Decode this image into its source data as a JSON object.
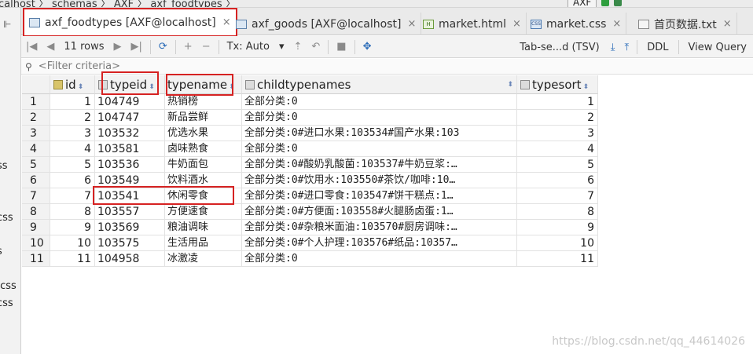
{
  "breadcrumb": {
    "path": "calhost 〉 schemas 〉 AXF 〉 axf_foodtypes 〉",
    "config": "AXF"
  },
  "sidebar": {
    "fragments": [
      "ss",
      "css",
      "s",
      ".css",
      "css"
    ]
  },
  "tabs": [
    {
      "label": "axf_foodtypes [AXF@localhost]",
      "icon": "table-icon",
      "active": true,
      "closable": true
    },
    {
      "label": "axf_goods [AXF@localhost]",
      "icon": "table-icon",
      "active": false,
      "closable": true
    },
    {
      "label": "market.html",
      "icon": "html-file-icon",
      "active": false,
      "closable": true
    },
    {
      "label": "market.css",
      "icon": "css-file-icon",
      "active": false,
      "closable": true
    },
    {
      "label": "首页数据.txt",
      "icon": "text-file-icon",
      "active": false,
      "closable": true
    }
  ],
  "toolbar": {
    "rows_label": "11 rows",
    "tx_label": "Tx: Auto",
    "format_label": "Tab-se...d (TSV)",
    "ddl_label": "DDL",
    "view_query_label": "View Query"
  },
  "filter": {
    "placeholder": "<Filter criteria>"
  },
  "columns": [
    {
      "name": "id",
      "icon": "key-column-icon"
    },
    {
      "name": "typeid",
      "icon": "column-icon"
    },
    {
      "name": "typename",
      "icon": "column-icon"
    },
    {
      "name": "childtypenames",
      "icon": "column-icon"
    },
    {
      "name": "typesort",
      "icon": "column-icon"
    }
  ],
  "rows": [
    {
      "n": "1",
      "id": "1",
      "typeid": "104749",
      "typename": "热销榜",
      "childtypenames": "全部分类:0",
      "typesort": "1"
    },
    {
      "n": "2",
      "id": "2",
      "typeid": "104747",
      "typename": "新品尝鲜",
      "childtypenames": "全部分类:0",
      "typesort": "2"
    },
    {
      "n": "3",
      "id": "3",
      "typeid": "103532",
      "typename": "优选水果",
      "childtypenames": "全部分类:0#进口水果:103534#国产水果:103",
      "typesort": "3"
    },
    {
      "n": "4",
      "id": "4",
      "typeid": "103581",
      "typename": "卤味熟食",
      "childtypenames": "全部分类:0",
      "typesort": "4"
    },
    {
      "n": "5",
      "id": "5",
      "typeid": "103536",
      "typename": "牛奶面包",
      "childtypenames": "全部分类:0#酸奶乳酸菌:103537#牛奶豆浆:…",
      "typesort": "5"
    },
    {
      "n": "6",
      "id": "6",
      "typeid": "103549",
      "typename": "饮料酒水",
      "childtypenames": "全部分类:0#饮用水:103550#茶饮/咖啡:10…",
      "typesort": "6"
    },
    {
      "n": "7",
      "id": "7",
      "typeid": "103541",
      "typename": "休闲零食",
      "childtypenames": "全部分类:0#进口零食:103547#饼干糕点:1…",
      "typesort": "7"
    },
    {
      "n": "8",
      "id": "8",
      "typeid": "103557",
      "typename": "方便速食",
      "childtypenames": "全部分类:0#方便面:103558#火腿肠卤蛋:1…",
      "typesort": "8"
    },
    {
      "n": "9",
      "id": "9",
      "typeid": "103569",
      "typename": "粮油调味",
      "childtypenames": "全部分类:0#杂粮米面油:103570#厨房调味:…",
      "typesort": "9"
    },
    {
      "n": "10",
      "id": "10",
      "typeid": "103575",
      "typename": "生活用品",
      "childtypenames": "全部分类:0#个人护理:103576#纸品:10357…",
      "typesort": "10"
    },
    {
      "n": "11",
      "id": "11",
      "typeid": "104958",
      "typename": "冰激凌",
      "childtypenames": "全部分类:0",
      "typesort": "11"
    }
  ],
  "watermark": "https://blog.csdn.net/qq_44614026",
  "colors": {
    "highlight": "#d62222",
    "accent": "#2b6cb8"
  }
}
